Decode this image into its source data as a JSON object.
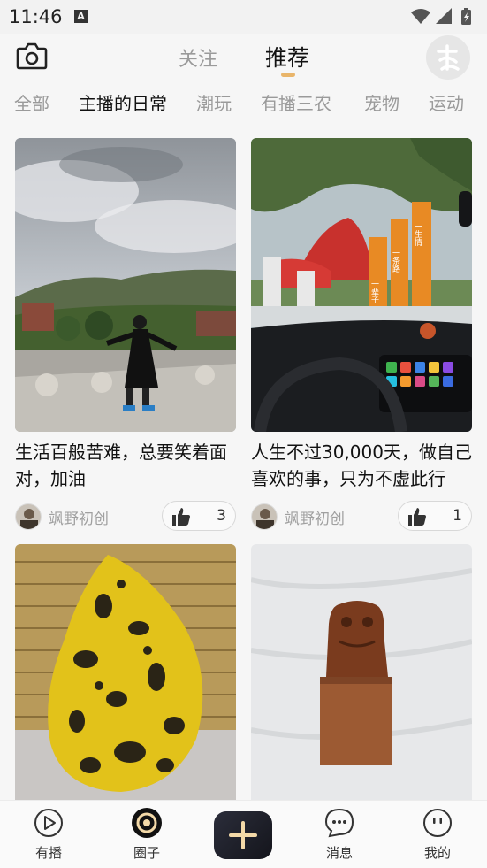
{
  "status_bar": {
    "time": "11:46",
    "notif_icon": "A"
  },
  "header": {
    "tab_follow": "关注",
    "tab_recommend": "推荐"
  },
  "categories": [
    "全部",
    "主播的日常",
    "潮玩",
    "有播三农",
    "宠物",
    "运动"
  ],
  "feed": [
    {
      "title": "生活百般苦难，总要笑着面对，加油",
      "author": "飒野初创",
      "likes": "3"
    },
    {
      "title": "人生不过30,000天，做自己喜欢的事，只为不虚此行",
      "author": "飒野初创",
      "likes": "1"
    },
    {
      "title": "",
      "author": "",
      "likes": ""
    },
    {
      "title": "",
      "author": "",
      "likes": ""
    }
  ],
  "photo_text": {
    "sign_1": "一生情",
    "sign_2": "一条路",
    "sign_3": "一辈子"
  },
  "bottom_nav": {
    "item_1": "有播",
    "item_2": "圈子",
    "item_4": "消息",
    "item_5": "我的"
  },
  "colors": {
    "accent": "#e9b56a",
    "active_text": "#111111",
    "inactive_text": "#9a9a9a"
  }
}
